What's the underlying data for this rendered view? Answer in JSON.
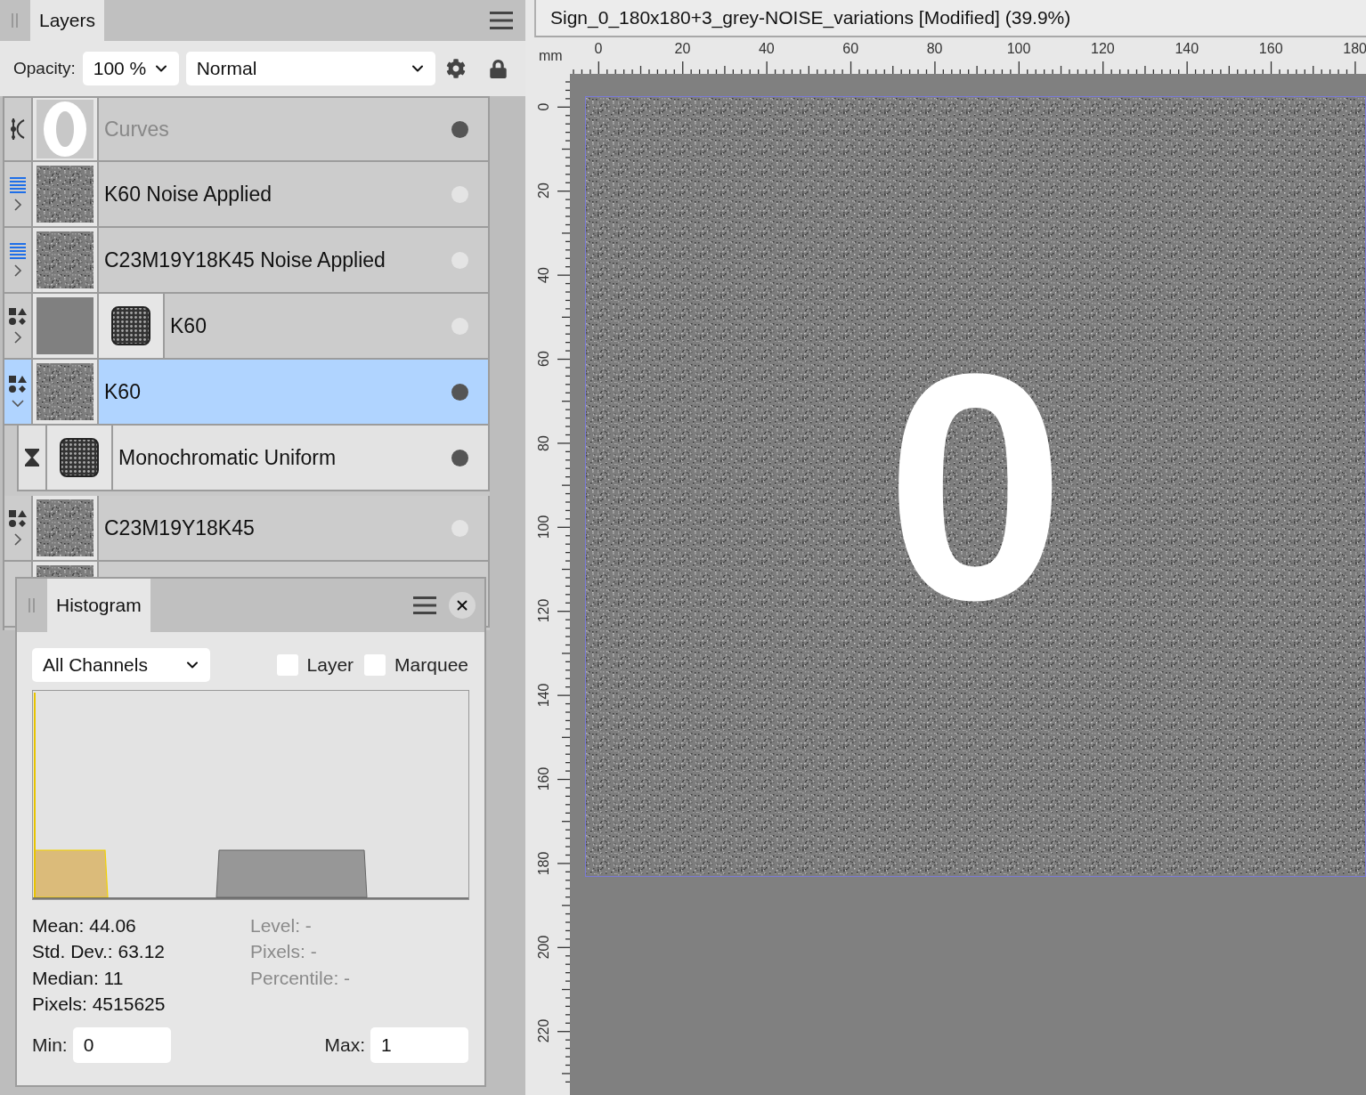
{
  "layers_panel": {
    "tab": "Layers",
    "opacity_label": "Opacity:",
    "opacity": "100 %",
    "blend_mode": "Normal",
    "layers": [
      {
        "name": "Curves",
        "kind": "adjustment",
        "thumbnail": {
          "kind": "glyph"
        },
        "disabled": true,
        "visible": true,
        "selected": false
      },
      {
        "name": "K60 Noise Applied",
        "kind": "filter_group",
        "thumbnail": {
          "kind": "noise"
        },
        "disabled": false,
        "visible": false,
        "selected": false,
        "expanded": false
      },
      {
        "name": "C23M19Y18K45 Noise Applied",
        "kind": "filter_group",
        "thumbnail": {
          "kind": "noise"
        },
        "disabled": false,
        "visible": false,
        "selected": false,
        "expanded": false
      },
      {
        "name": "K60",
        "kind": "shapes",
        "thumbnail": {
          "kind": "flat"
        },
        "mask": {
          "kind": "pattern"
        },
        "disabled": false,
        "visible": false,
        "selected": false,
        "expanded": false
      },
      {
        "name": "K60",
        "kind": "shapes",
        "thumbnail": {
          "kind": "noise"
        },
        "disabled": false,
        "visible": true,
        "selected": true,
        "expanded": true,
        "children": [
          {
            "name": "Monochromatic Uniform",
            "kind": "live_filter",
            "thumbnail": {
              "kind": "pattern"
            },
            "disabled": false,
            "visible": true,
            "selected": false
          }
        ]
      },
      {
        "name": "C23M19Y18K45",
        "kind": "shapes",
        "thumbnail": {
          "kind": "noise"
        },
        "disabled": false,
        "visible": false,
        "selected": false,
        "expanded": false
      },
      {
        "thumbnail": {
          "kind": "noise"
        },
        "selected": false
      }
    ]
  },
  "histogram": {
    "tab": "Histogram",
    "channel": "All Channels",
    "checkboxes": [
      {
        "label": "Layer",
        "checked": false
      },
      {
        "label": "Marquee",
        "checked": false
      }
    ],
    "stats": [
      "Mean: 44.06",
      "Std. Dev.: 63.12",
      "Median: 11",
      "Pixels: 4515625"
    ],
    "cursor_stats": [
      "Level: -",
      "Pixels: -",
      "Percentile: -"
    ],
    "min_label": "Min:",
    "min": "0",
    "max_label": "Max:",
    "max": "1"
  },
  "document": {
    "title": "Sign_0_180x180+3_grey-NOISE_variations [Modified] (39.9%)",
    "glyph": "0"
  },
  "rulers": {
    "unit": "mm",
    "top_labels": [
      "0",
      "20",
      "40",
      "60",
      "80",
      "100",
      "120",
      "140",
      "160",
      "180"
    ],
    "left_labels": [
      "0",
      "20",
      "40",
      "60",
      "80",
      "100",
      "120",
      "140",
      "160",
      "180",
      "200",
      "220"
    ]
  }
}
